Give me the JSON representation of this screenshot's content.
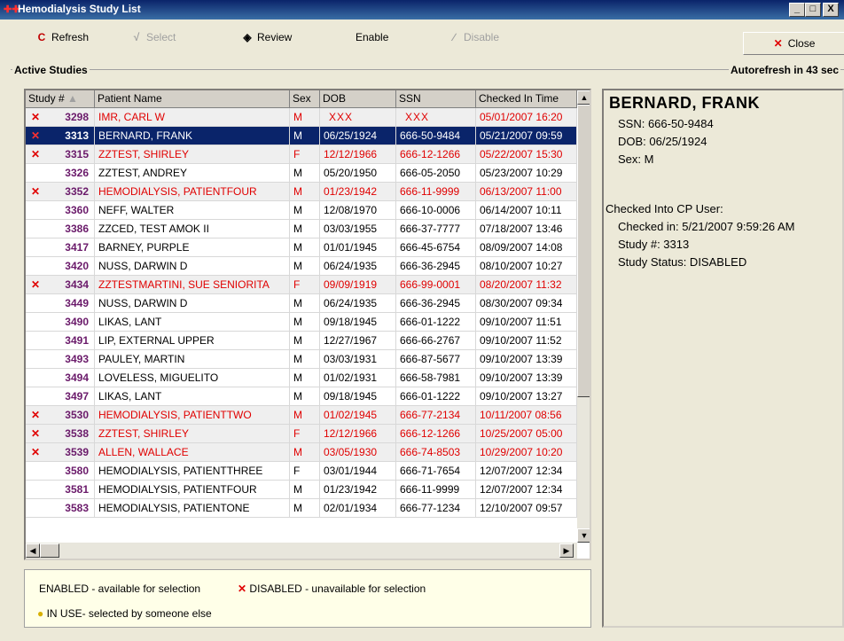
{
  "window": {
    "title": "Hemodialysis Study List",
    "controls": [
      "_",
      "□",
      "X"
    ]
  },
  "toolbar": {
    "refresh": "Refresh",
    "select": "Select",
    "review": "Review",
    "enable": "Enable",
    "disable": "Disable",
    "close": "Close"
  },
  "group": {
    "label": "Active Studies",
    "autorefresh": "Autorefresh in 43 sec"
  },
  "columns": [
    "Study #",
    "Patient Name",
    "Sex",
    "DOB",
    "SSN",
    "Checked In Time"
  ],
  "rows": [
    {
      "no": "3298",
      "name": "IMR, CARL W",
      "sex": "M",
      "dob": "XXX",
      "ssn": "XXX",
      "checked": "05/01/2007 16:20",
      "disabled": true
    },
    {
      "no": "3313",
      "name": "BERNARD, FRANK",
      "sex": "M",
      "dob": "06/25/1924",
      "ssn": "666-50-9484",
      "checked": "05/21/2007 09:59",
      "disabled": true,
      "selected": true
    },
    {
      "no": "3315",
      "name": "ZZTEST, SHIRLEY",
      "sex": "F",
      "dob": "12/12/1966",
      "ssn": "666-12-1266",
      "checked": "05/22/2007 15:30",
      "disabled": true
    },
    {
      "no": "3326",
      "name": "ZZTEST, ANDREY",
      "sex": "M",
      "dob": "05/20/1950",
      "ssn": "666-05-2050",
      "checked": "05/23/2007 10:29",
      "disabled": false
    },
    {
      "no": "3352",
      "name": "HEMODIALYSIS, PATIENTFOUR",
      "sex": "M",
      "dob": "01/23/1942",
      "ssn": "666-11-9999",
      "checked": "06/13/2007 11:00",
      "disabled": true
    },
    {
      "no": "3360",
      "name": "NEFF, WALTER",
      "sex": "M",
      "dob": "12/08/1970",
      "ssn": "666-10-0006",
      "checked": "06/14/2007 10:11",
      "disabled": false
    },
    {
      "no": "3386",
      "name": "ZZCED, TEST AMOK II",
      "sex": "M",
      "dob": "03/03/1955",
      "ssn": "666-37-7777",
      "checked": "07/18/2007 13:46",
      "disabled": false
    },
    {
      "no": "3417",
      "name": "BARNEY, PURPLE",
      "sex": "M",
      "dob": "01/01/1945",
      "ssn": "666-45-6754",
      "checked": "08/09/2007 14:08",
      "disabled": false
    },
    {
      "no": "3420",
      "name": "NUSS, DARWIN D",
      "sex": "M",
      "dob": "06/24/1935",
      "ssn": "666-36-2945",
      "checked": "08/10/2007 10:27",
      "disabled": false
    },
    {
      "no": "3434",
      "name": "ZZTESTMARTINI, SUE SENIORITA",
      "sex": "F",
      "dob": "09/09/1919",
      "ssn": "666-99-0001",
      "checked": "08/20/2007 11:32",
      "disabled": true
    },
    {
      "no": "3449",
      "name": "NUSS, DARWIN D",
      "sex": "M",
      "dob": "06/24/1935",
      "ssn": "666-36-2945",
      "checked": "08/30/2007 09:34",
      "disabled": false
    },
    {
      "no": "3490",
      "name": "LIKAS, LANT",
      "sex": "M",
      "dob": "09/18/1945",
      "ssn": "666-01-1222",
      "checked": "09/10/2007 11:51",
      "disabled": false
    },
    {
      "no": "3491",
      "name": "LIP, EXTERNAL UPPER",
      "sex": "M",
      "dob": "12/27/1967",
      "ssn": "666-66-2767",
      "checked": "09/10/2007 11:52",
      "disabled": false
    },
    {
      "no": "3493",
      "name": "PAULEY, MARTIN",
      "sex": "M",
      "dob": "03/03/1931",
      "ssn": "666-87-5677",
      "checked": "09/10/2007 13:39",
      "disabled": false
    },
    {
      "no": "3494",
      "name": "LOVELESS, MIGUELITO",
      "sex": "M",
      "dob": "01/02/1931",
      "ssn": "666-58-7981",
      "checked": "09/10/2007 13:39",
      "disabled": false
    },
    {
      "no": "3497",
      "name": "LIKAS, LANT",
      "sex": "M",
      "dob": "09/18/1945",
      "ssn": "666-01-1222",
      "checked": "09/10/2007 13:27",
      "disabled": false
    },
    {
      "no": "3530",
      "name": "HEMODIALYSIS, PATIENTTWO",
      "sex": "M",
      "dob": "01/02/1945",
      "ssn": "666-77-2134",
      "checked": "10/11/2007 08:56",
      "disabled": true
    },
    {
      "no": "3538",
      "name": "ZZTEST, SHIRLEY",
      "sex": "F",
      "dob": "12/12/1966",
      "ssn": "666-12-1266",
      "checked": "10/25/2007 05:00",
      "disabled": true
    },
    {
      "no": "3539",
      "name": "ALLEN, WALLACE",
      "sex": "M",
      "dob": "03/05/1930",
      "ssn": "666-74-8503",
      "checked": "10/29/2007 10:20",
      "disabled": true
    },
    {
      "no": "3580",
      "name": "HEMODIALYSIS, PATIENTTHREE",
      "sex": "F",
      "dob": "03/01/1944",
      "ssn": "666-71-7654",
      "checked": "12/07/2007 12:34",
      "disabled": false
    },
    {
      "no": "3581",
      "name": "HEMODIALYSIS, PATIENTFOUR",
      "sex": "M",
      "dob": "01/23/1942",
      "ssn": "666-11-9999",
      "checked": "12/07/2007 12:34",
      "disabled": false
    },
    {
      "no": "3583",
      "name": "HEMODIALYSIS, PATIENTONE",
      "sex": "M",
      "dob": "02/01/1934",
      "ssn": "666-77-1234",
      "checked": "12/10/2007 09:57",
      "disabled": false
    }
  ],
  "legend": {
    "enabled": "ENABLED - available for selection",
    "disabled": "DISABLED - unavailable for selection",
    "inuse": "IN USE- selected by someone else"
  },
  "detail": {
    "name": "BERNARD, FRANK",
    "ssn": "SSN: 666-50-9484",
    "dob": "DOB: 06/25/1924",
    "sex": "Sex: M",
    "checked_into": "Checked Into CP User:",
    "checked_in": "Checked in: 5/21/2007 9:59:26 AM",
    "study": "Study #: 3313",
    "status": "Study Status: DISABLED"
  },
  "colors": {
    "disabled_text": "#e00000",
    "selected_bg": "#0a246a",
    "study_no": "#6a1a6a"
  }
}
